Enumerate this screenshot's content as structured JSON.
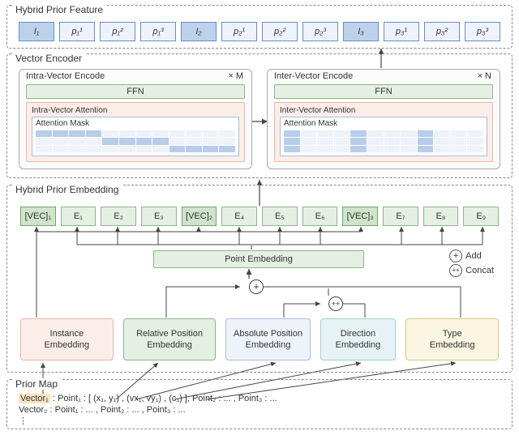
{
  "hpf": {
    "title": "Hybrid Prior Feature",
    "items": [
      {
        "label": "I₁",
        "vec": true
      },
      {
        "label": "p₁¹",
        "vec": false
      },
      {
        "label": "p₁²",
        "vec": false
      },
      {
        "label": "p₁³",
        "vec": false
      },
      {
        "label": "I₂",
        "vec": true
      },
      {
        "label": "p₂¹",
        "vec": false
      },
      {
        "label": "p₂²",
        "vec": false
      },
      {
        "label": "p₂³",
        "vec": false
      },
      {
        "label": "I₃",
        "vec": true
      },
      {
        "label": "p₃¹",
        "vec": false
      },
      {
        "label": "p₃²",
        "vec": false
      },
      {
        "label": "p₃³",
        "vec": false
      }
    ]
  },
  "venc": {
    "title": "Vector Encoder",
    "intra": {
      "title": "Intra-Vector Encode",
      "mult": "× M",
      "ffn": "FFN",
      "attn_title": "Intra-Vector Attention",
      "mask_label": "Attention Mask"
    },
    "inter": {
      "title": "Inter-Vector Encode",
      "mult": "× N",
      "ffn": "FFN",
      "attn_title": "Inter-Vector Attention",
      "mask_label": "Attention Mask"
    }
  },
  "hpe": {
    "title": "Hybrid Prior Embedding",
    "row": [
      {
        "label": "[VEC]₁",
        "vec": true
      },
      {
        "label": "E₁",
        "vec": false
      },
      {
        "label": "E₂",
        "vec": false
      },
      {
        "label": "E₃",
        "vec": false
      },
      {
        "label": "[VEC]₂",
        "vec": true
      },
      {
        "label": "E₄",
        "vec": false
      },
      {
        "label": "E₅",
        "vec": false
      },
      {
        "label": "E₆",
        "vec": false
      },
      {
        "label": "[VEC]₃",
        "vec": true
      },
      {
        "label": "E₇",
        "vec": false
      },
      {
        "label": "E₈",
        "vec": false
      },
      {
        "label": "E₉",
        "vec": false
      }
    ],
    "point_embedding": "Point Embedding",
    "legend_add": "Add",
    "legend_concat": "Concat",
    "cards": {
      "instance": "Instance\nEmbedding",
      "relative": "Relative Position\nEmbedding",
      "absolute": "Absolute Position\nEmbedding",
      "direction": "Direction\nEmbedding",
      "type": "Type\nEmbedding"
    }
  },
  "pmap": {
    "title": "Prior Map",
    "line1_vec": "Vector₁",
    "line1_rest": " :   Point₁ : [ (x₁, y₁) , (vx₁, vy₁) , (c₁) ],   Point₂ : ... ,   Point₃ : ...",
    "line2": "Vector₂ :   Point₁ : ... ,   Point₂ : ... ,   Point₃ : ...",
    "line3": "⋮"
  }
}
